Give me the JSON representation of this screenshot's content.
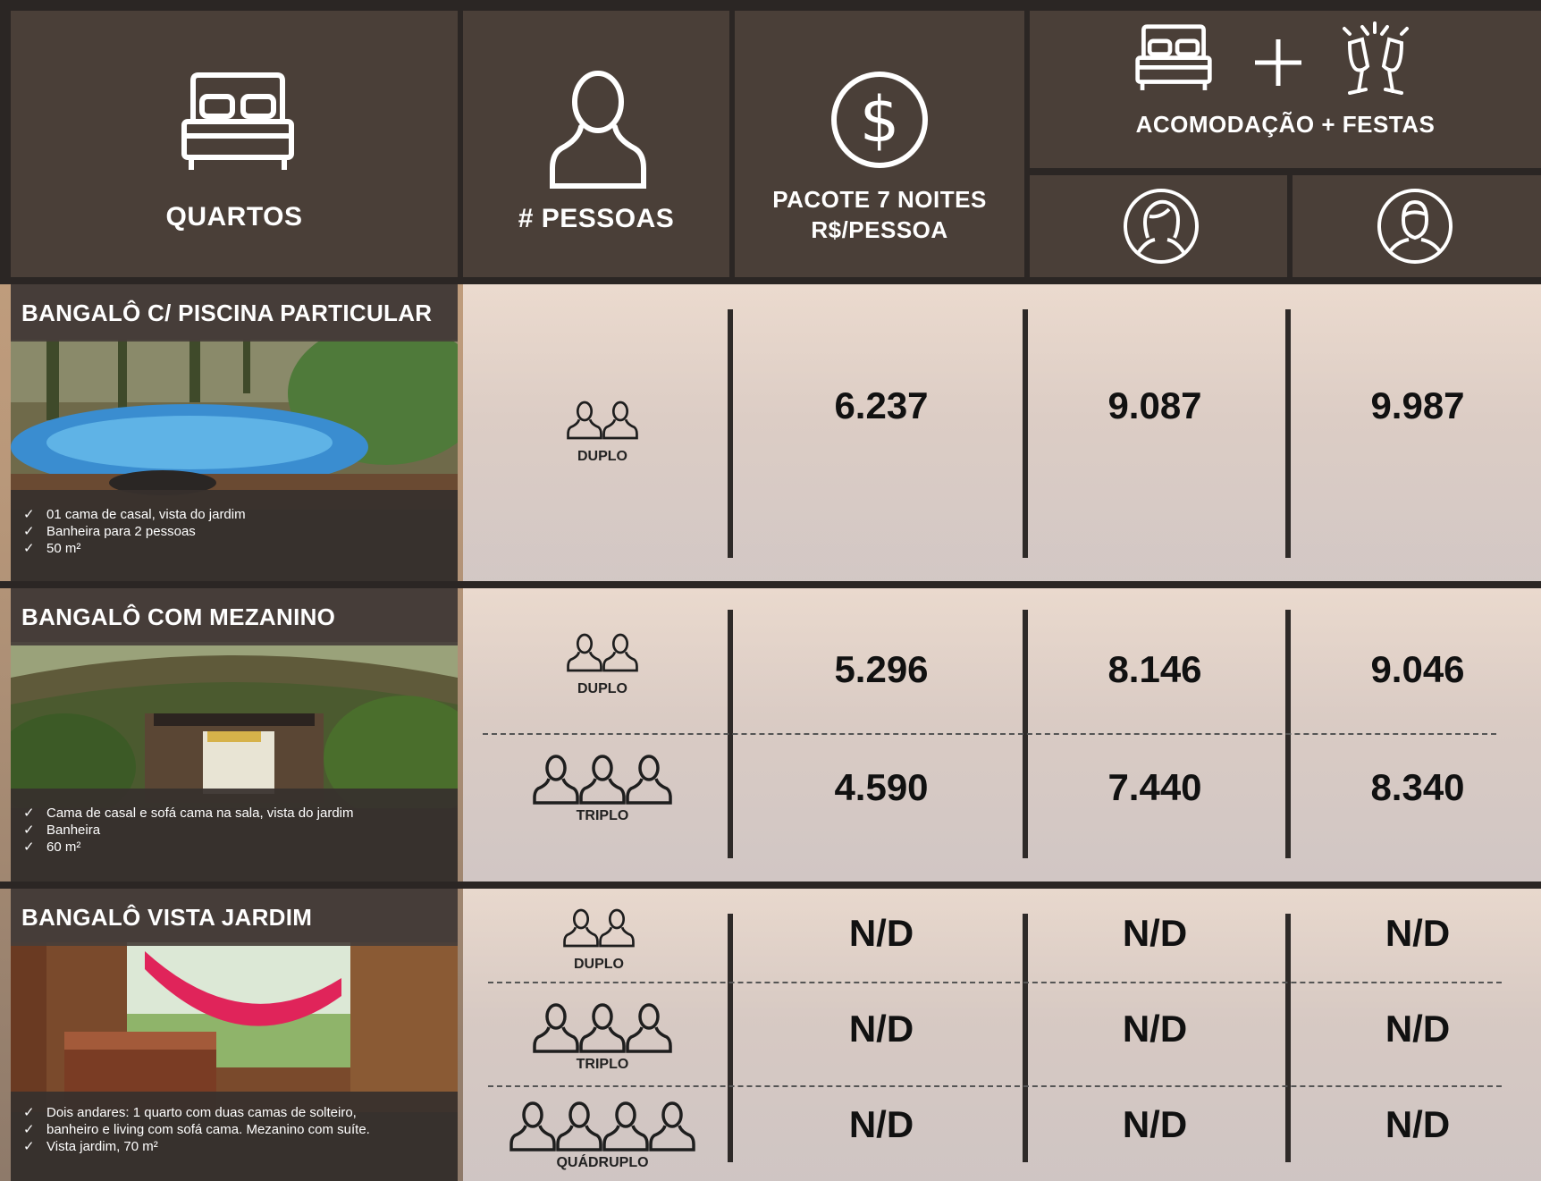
{
  "header": {
    "rooms": "QUARTOS",
    "people": "# PESSOAS",
    "package_line1": "PACOTE 7 NOITES",
    "package_line2": "R$/PESSOA",
    "combo": "ACOMODAÇÃO + FESTAS"
  },
  "rooms": [
    {
      "title": "BANGALÔ C/ PISCINA PARTICULAR",
      "features": [
        "01 cama de casal, vista do jardim",
        "Banheira para 2 pessoas",
        "50 m²"
      ],
      "rows": [
        {
          "occupancy": "DUPLO",
          "package": "6.237",
          "female": "9.087",
          "male": "9.987"
        }
      ]
    },
    {
      "title": "BANGALÔ COM MEZANINO",
      "features": [
        "Cama de casal e sofá cama na sala, vista do jardim",
        "Banheira",
        "60 m²"
      ],
      "rows": [
        {
          "occupancy": "DUPLO",
          "package": "5.296",
          "female": "8.146",
          "male": "9.046"
        },
        {
          "occupancy": "TRIPLO",
          "package": "4.590",
          "female": "7.440",
          "male": "8.340"
        }
      ]
    },
    {
      "title": "BANGALÔ VISTA JARDIM",
      "features": [
        "Dois andares: 1 quarto com duas camas de solteiro,",
        "banheiro e living com sofá cama. Mezanino com suíte.",
        "Vista jardim, 70 m²"
      ],
      "rows": [
        {
          "occupancy": "DUPLO",
          "package": "N/D",
          "female": "N/D",
          "male": "N/D"
        },
        {
          "occupancy": "TRIPLO",
          "package": "N/D",
          "female": "N/D",
          "male": "N/D"
        },
        {
          "occupancy": "QUÁDRUPLO",
          "package": "N/D",
          "female": "N/D",
          "male": "N/D"
        }
      ]
    }
  ],
  "check_mark": "✓",
  "icons": {
    "bed": "bed-icon",
    "person": "person-icon",
    "dollar": "dollar-circle-icon",
    "plus": "plus-icon",
    "toast": "champagne-toast-icon",
    "female": "female-avatar-icon",
    "male": "male-avatar-icon",
    "people": "people-group-icon"
  },
  "colors": {
    "header_bg": "#4a3f38",
    "separator": "#2b2624",
    "text_dark": "#111111",
    "text_light": "#ffffff"
  }
}
